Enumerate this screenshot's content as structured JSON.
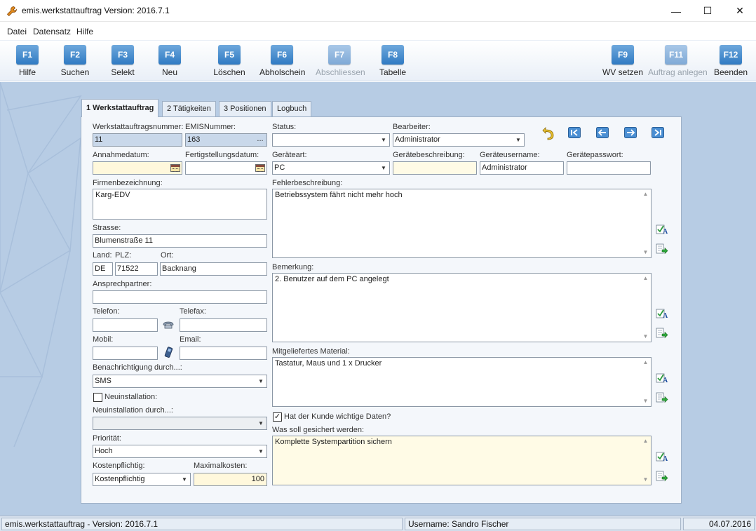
{
  "window": {
    "title": "emis.werkstattauftrag Version: 2016.7.1",
    "min_glyph": "—",
    "max_glyph": "☐",
    "close_glyph": "✕"
  },
  "menu": {
    "items": [
      "Datei",
      "Datensatz",
      "Hilfe"
    ]
  },
  "toolbar": {
    "buttons": [
      {
        "key": "F1",
        "label": "Hilfe",
        "enabled": true
      },
      {
        "key": "F2",
        "label": "Suchen",
        "enabled": true
      },
      {
        "key": "F3",
        "label": "Selekt",
        "enabled": true
      },
      {
        "key": "F4",
        "label": "Neu",
        "enabled": true
      },
      {
        "key": "F5",
        "label": "Löschen",
        "enabled": true
      },
      {
        "key": "F6",
        "label": "Abholschein",
        "enabled": true
      },
      {
        "key": "F7",
        "label": "Abschliessen",
        "enabled": false
      },
      {
        "key": "F8",
        "label": "Tabelle",
        "enabled": true
      },
      {
        "key": "F9",
        "label": "WV setzen",
        "enabled": true
      },
      {
        "key": "F11",
        "label": "Auftrag anlegen",
        "enabled": false
      },
      {
        "key": "F12",
        "label": "Beenden",
        "enabled": true
      }
    ]
  },
  "tabs": [
    {
      "label": "1 Werkstattauftrag",
      "active": true
    },
    {
      "label": "2 Tätigkeiten",
      "active": false
    },
    {
      "label": "3 Positionen",
      "active": false
    },
    {
      "label": "Logbuch",
      "active": false
    }
  ],
  "form": {
    "werkstattauftragsnummer": {
      "label": "Werkstattauftragsnummer:",
      "value": "11"
    },
    "emisnummer": {
      "label": "EMISNummer:",
      "value": "163",
      "button": "..."
    },
    "annahmedatum": {
      "label": "Annahmedatum:",
      "value": ""
    },
    "fertigstellungsdatum": {
      "label": "Fertigstellungsdatum:",
      "value": ""
    },
    "firmenbezeichnung": {
      "label": "Firmenbezeichnung:",
      "value": "Karg-EDV"
    },
    "strasse": {
      "label": "Strasse:",
      "value": "Blumenstraße 11"
    },
    "land": {
      "label": "Land:",
      "value": "DE"
    },
    "plz": {
      "label": "PLZ:",
      "value": "71522"
    },
    "ort": {
      "label": "Ort:",
      "value": "Backnang"
    },
    "ansprechpartner": {
      "label": "Ansprechpartner:",
      "value": ""
    },
    "telefon": {
      "label": "Telefon:",
      "value": ""
    },
    "telefax": {
      "label": "Telefax:",
      "value": ""
    },
    "mobil": {
      "label": "Mobil:",
      "value": ""
    },
    "email": {
      "label": "Email:",
      "value": ""
    },
    "benachrichtigung": {
      "label": "Benachrichtigung durch...:",
      "value": "SMS"
    },
    "neuinstallation": {
      "label": "Neuinstallation:",
      "checked": false
    },
    "neuinstallation_durch": {
      "label": "Neuinstallation durch...:",
      "value": ""
    },
    "prioritaet": {
      "label": "Priorität:",
      "value": "Hoch"
    },
    "kostenpflichtig": {
      "label": "Kostenpflichtig:",
      "value": "Kostenpflichtig"
    },
    "maximalkosten": {
      "label": "Maximalkosten:",
      "value": "100"
    },
    "status": {
      "label": "Status:",
      "value": ""
    },
    "bearbeiter": {
      "label": "Bearbeiter:",
      "value": "Administrator"
    },
    "geraeteart": {
      "label": "Geräteart:",
      "value": "PC"
    },
    "geraetebeschreibung": {
      "label": "Gerätebeschreibung:",
      "value": ""
    },
    "geraeteusername": {
      "label": "Geräteusername:",
      "value": "Administrator"
    },
    "geraetepasswort": {
      "label": "Gerätepasswort:",
      "value": ""
    },
    "fehlerbeschreibung": {
      "label": "Fehlerbeschreibung:",
      "value": "Betriebssystem fährt nicht mehr hoch"
    },
    "bemerkung": {
      "label": "Bemerkung:",
      "value": "2. Benutzer auf dem PC angelegt"
    },
    "mitgeliefertes_material": {
      "label": "Mitgeliefertes Material:",
      "value": "Tastatur, Maus und 1 x Drucker"
    },
    "wichtige_daten": {
      "label": "Hat der Kunde wichtige Daten?",
      "checked": true
    },
    "was_sichern": {
      "label": "Was soll gesichert werden:",
      "value": "Komplette Systempartition sichern"
    }
  },
  "statusbar": {
    "app": "emis.werkstattauftrag - Version: 2016.7.1",
    "user": "Username: Sandro Fischer",
    "date": "04.07.2016"
  },
  "colors": {
    "toolbar_key": "#2f7ac3",
    "workspace": "#b7cce4",
    "panel": "#f4f7fb",
    "readonly_field": "#c9d8ea",
    "required_field": "#fff8dc"
  }
}
